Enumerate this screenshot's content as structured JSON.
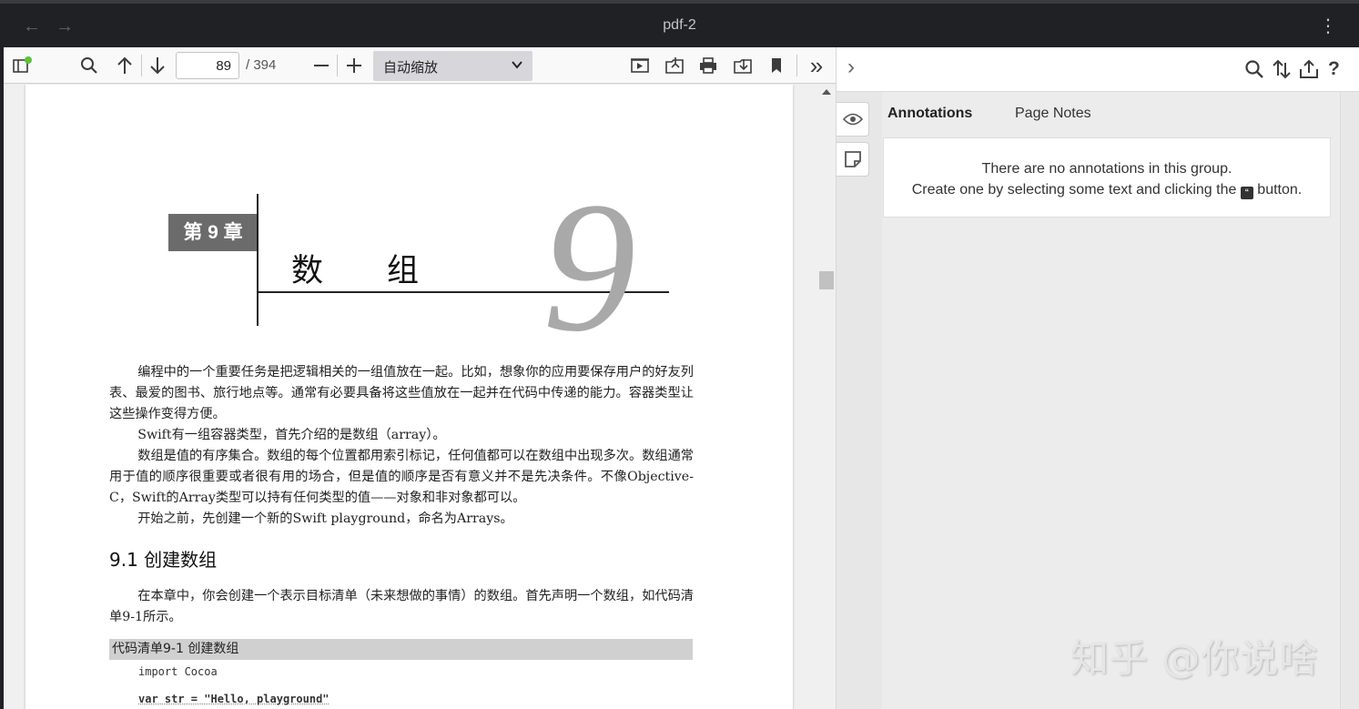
{
  "window": {
    "title": "pdf-2",
    "back_icon": "←",
    "forward_icon": "→",
    "menu_icon": "⋮"
  },
  "toolbar": {
    "page_number": "89",
    "page_total": "/ 394",
    "zoom_label": "自动缩放",
    "more_label": "»"
  },
  "document": {
    "chapter_badge": "第 9 章",
    "chapter_title": "数组",
    "chapter_number": "9",
    "paragraphs": [
      "编程中的一个重要任务是把逻辑相关的一组值放在一起。比如，想象你的应用要保存用户的好友列表、最爱的图书、旅行地点等。通常有必要具备将这些值放在一起并在代码中传递的能力。容器类型让这些操作变得方便。",
      "Swift有一组容器类型，首先介绍的是数组（array）。",
      "数组是值的有序集合。数组的每个位置都用索引标记，任何值都可以在数组中出现多次。数组通常用于值的顺序很重要或者很有用的场合，但是值的顺序是否有意义并不是先决条件。不像Objective-C，Swift的Array类型可以持有任何类型的值——对象和非对象都可以。",
      "开始之前，先创建一个新的Swift playground，命名为Arrays。"
    ],
    "section_title": "9.1   创建数组",
    "section_paragraph": "在本章中，你会创建一个表示目标清单（未来想做的事情）的数组。首先声明一个数组，如代码清单9-1所示。",
    "code_header": "代码清单9-1   创建数组",
    "code_lines": [
      "import Cocoa",
      "var str = \"Hello, playground\""
    ]
  },
  "sidebar": {
    "collapse_icon": "›",
    "tabs": [
      "Annotations",
      "Page Notes"
    ],
    "empty_line1": "There are no annotations in this group.",
    "empty_line2_before": "Create one by selecting some text and clicking the",
    "empty_line2_after": "button.",
    "annotate_glyph": "“"
  },
  "watermark": "知乎 @你说啥"
}
